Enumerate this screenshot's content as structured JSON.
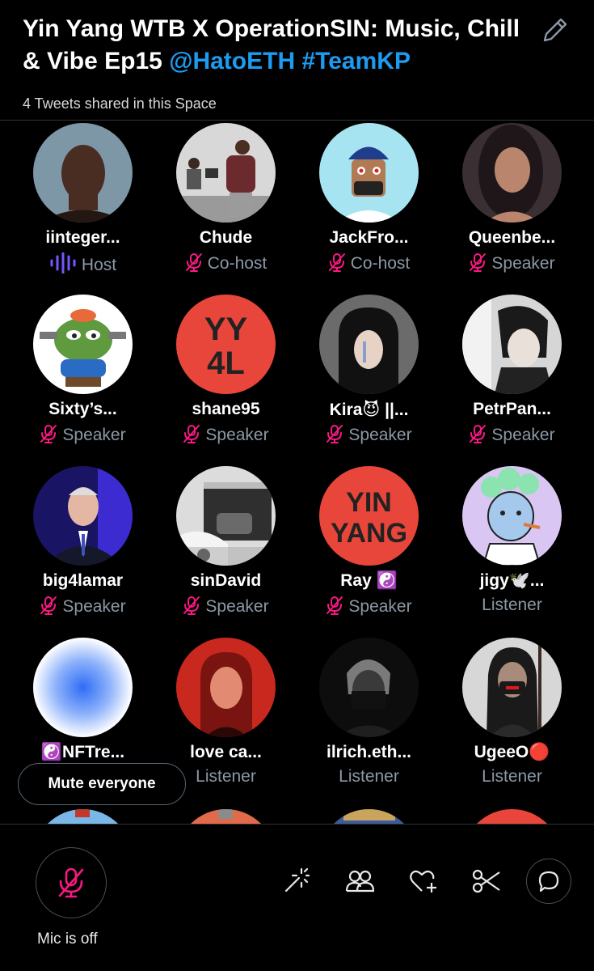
{
  "header": {
    "title_text": "Yin Yang WTB X OperationSIN: Music, Chill & Vibe Ep15 ",
    "title_mention": "@HatoETH",
    "title_hashtag": "#TeamKP",
    "shared_tweets": "4 Tweets shared in this Space"
  },
  "participants": [
    {
      "name": "iinteger...",
      "role": "Host",
      "icon": "speaking-wave-icon"
    },
    {
      "name": "Chude",
      "role": "Co-host",
      "icon": "mic-off-icon"
    },
    {
      "name": "JackFro...",
      "role": "Co-host",
      "icon": "mic-off-icon"
    },
    {
      "name": "Queenbe...",
      "role": "Speaker",
      "icon": "mic-off-icon"
    },
    {
      "name": "Sixty’s...",
      "role": "Speaker",
      "icon": "mic-off-icon"
    },
    {
      "name": "shane95",
      "role": "Speaker",
      "icon": "mic-off-icon"
    },
    {
      "name": "Kira😈 ||...",
      "role": "Speaker",
      "icon": "mic-off-icon"
    },
    {
      "name": "PetrPan...",
      "role": "Speaker",
      "icon": "mic-off-icon"
    },
    {
      "name": "big4lamar",
      "role": "Speaker",
      "icon": "mic-off-icon"
    },
    {
      "name": "sinDavid",
      "role": "Speaker",
      "icon": "mic-off-icon"
    },
    {
      "name": "Ray ☯️",
      "role": "Speaker",
      "icon": "mic-off-icon"
    },
    {
      "name": "jigy🕊️...",
      "role": "Listener",
      "icon": ""
    },
    {
      "name": "☯️NFTre...",
      "role": "",
      "icon": ""
    },
    {
      "name": "love ca...",
      "role": "Listener",
      "icon": ""
    },
    {
      "name": "ilrich.eth...",
      "role": "Listener",
      "icon": ""
    },
    {
      "name": "UgeeO🔴",
      "role": "Listener",
      "icon": ""
    },
    {
      "name": "",
      "role": "",
      "icon": ""
    },
    {
      "name": "",
      "role": "",
      "icon": ""
    },
    {
      "name": "",
      "role": "",
      "icon": ""
    },
    {
      "name": "",
      "role": "",
      "icon": ""
    }
  ],
  "avatar_text": {
    "shane95": {
      "line1": "YY",
      "line2": "4L"
    },
    "ray": {
      "line1": "YIN",
      "line2": "YANG"
    }
  },
  "mute_everyone_label": "Mute everyone",
  "bottom_bar": {
    "mic_label": "Mic is off",
    "tools": [
      "magic-wand-icon",
      "people-icon",
      "heart-plus-icon",
      "scissors-icon",
      "chat-bubble-icon"
    ]
  },
  "colors": {
    "accent_blue": "#1d9bf0",
    "mute_red": "#f91880",
    "host_purple": "#7856ff",
    "role_gray": "#8b98a5"
  }
}
